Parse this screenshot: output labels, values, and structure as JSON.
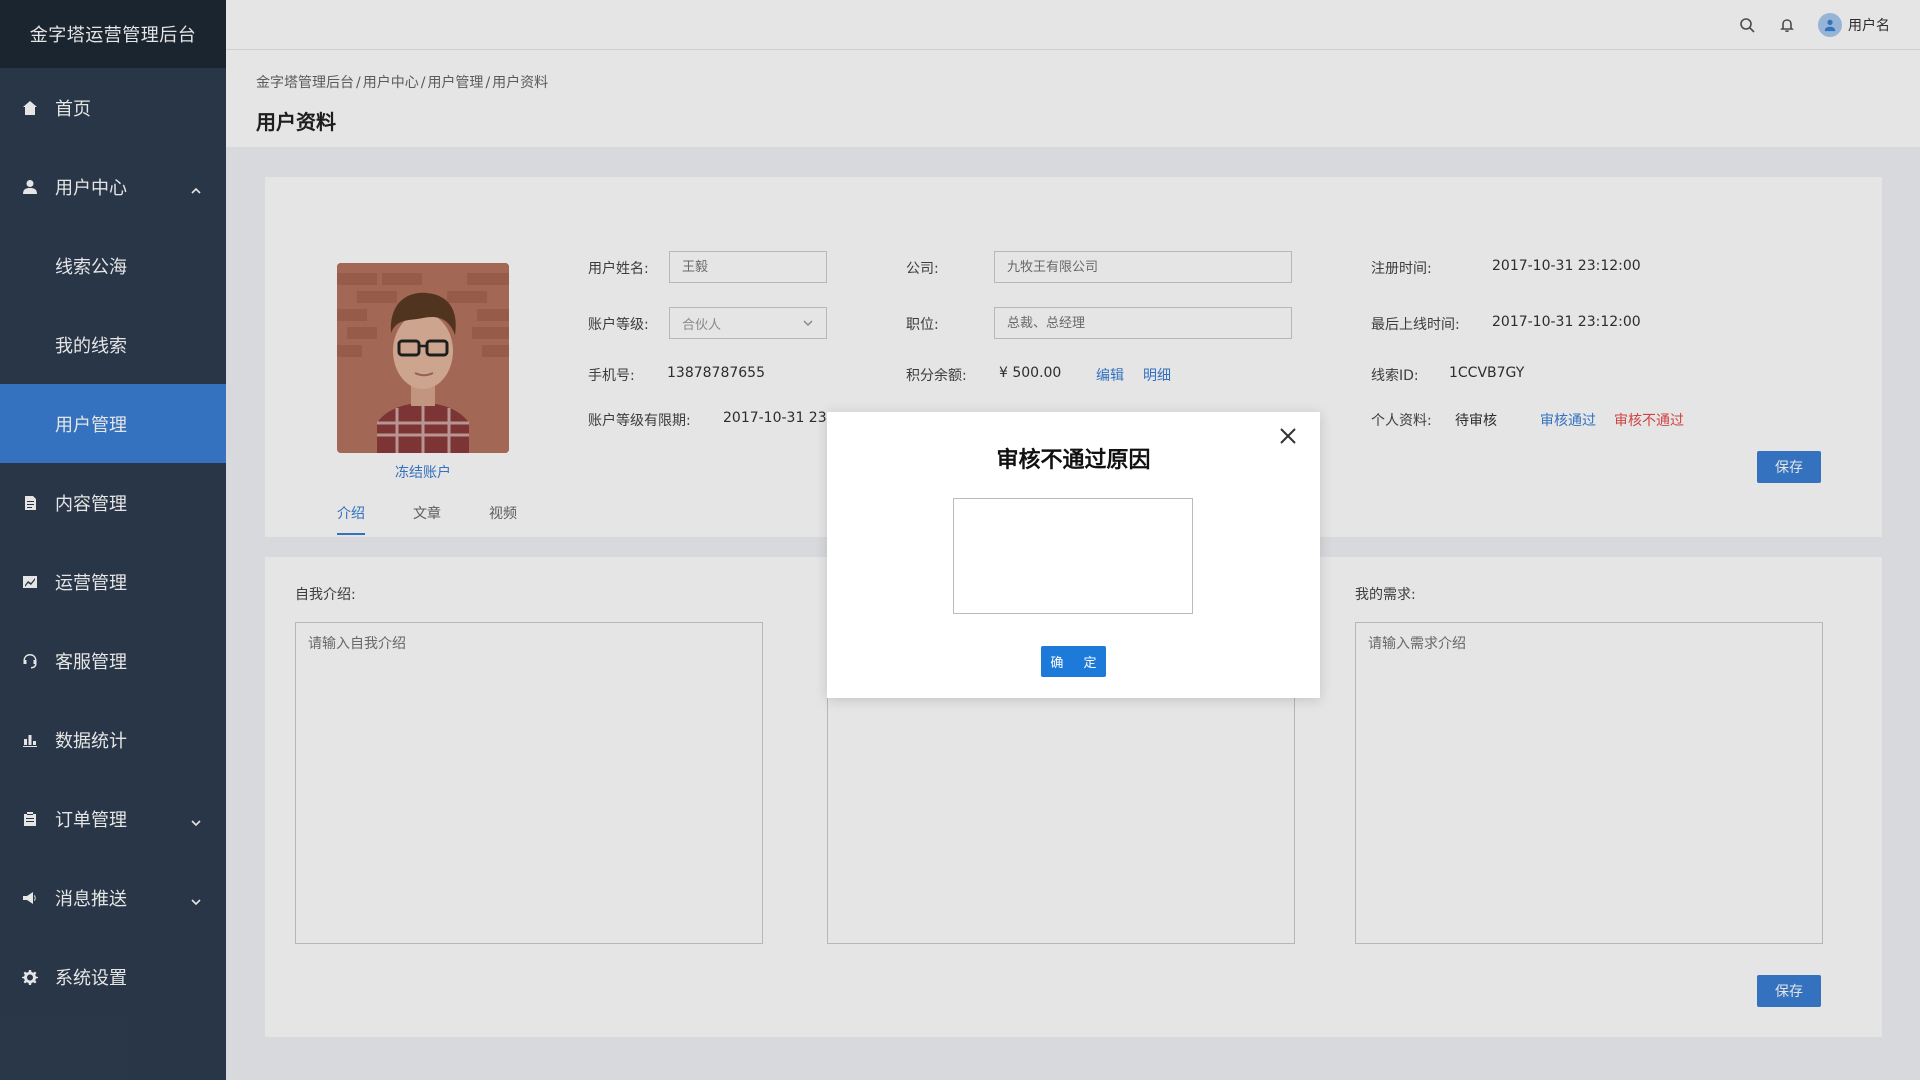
{
  "app": {
    "title": "金字塔运营管理后台"
  },
  "sidebar": {
    "items": [
      {
        "label": "首页",
        "icon": "home-icon"
      },
      {
        "label": "用户中心",
        "icon": "user-icon",
        "expanded": true
      },
      {
        "label": "线索公海"
      },
      {
        "label": "我的线索"
      },
      {
        "label": "用户管理",
        "active": true
      },
      {
        "label": "内容管理",
        "icon": "document-icon"
      },
      {
        "label": "运营管理",
        "icon": "chart-card-icon"
      },
      {
        "label": "客服管理",
        "icon": "headset-icon"
      },
      {
        "label": "数据统计",
        "icon": "bar-chart-icon"
      },
      {
        "label": "订单管理",
        "icon": "clipboard-icon",
        "expanded": false
      },
      {
        "label": "消息推送",
        "icon": "megaphone-icon",
        "expanded": false
      },
      {
        "label": "系统设置",
        "icon": "gear-icon"
      }
    ]
  },
  "topbar": {
    "username": "用户名"
  },
  "breadcrumb": [
    "金字塔管理后台",
    "用户中心",
    "用户管理",
    "用户资料"
  ],
  "page_title": "用户资料",
  "profile": {
    "freeze_label": "冻结账户",
    "name_label": "用户姓名:",
    "name_placeholder": "王毅",
    "level_label": "账户等级:",
    "level_value": "合伙人",
    "phone_label": "手机号:",
    "phone_value": "13878787655",
    "expire_label": "账户等级有限期:",
    "expire_value": "2017-10-31  23:",
    "company_label": "公司:",
    "company_placeholder": "九牧王有限公司",
    "position_label": "职位:",
    "position_placeholder": "总裁、总经理",
    "points_label": "积分余额:",
    "points_value": "¥ 500.00",
    "edit_link": "编辑",
    "detail_link": "明细",
    "reg_label": "注册时间:",
    "reg_value": "2017-10-31  23:12:00",
    "last_label": "最后上线时间:",
    "last_value": "2017-10-31  23:12:00",
    "lead_label": "线索ID:",
    "lead_value": "1CCVB7GY",
    "info_label": "个人资料:",
    "info_status": "待审核",
    "approve_link": "审核通过",
    "reject_link": "审核不通过",
    "save_label": "保存"
  },
  "tabs": [
    "介绍",
    "文章",
    "视频"
  ],
  "intro": {
    "self_label": "自我介绍:",
    "self_placeholder": "请输入自我介绍",
    "need_label": "我的需求:",
    "need_placeholder": "请输入需求介绍",
    "save_label": "保存"
  },
  "modal": {
    "title": "审核不通过原因",
    "confirm_label": "确 定"
  },
  "colors": {
    "sidebar": "#2e3d50",
    "accent": "#3a7fd5",
    "danger": "#e94b4b"
  }
}
